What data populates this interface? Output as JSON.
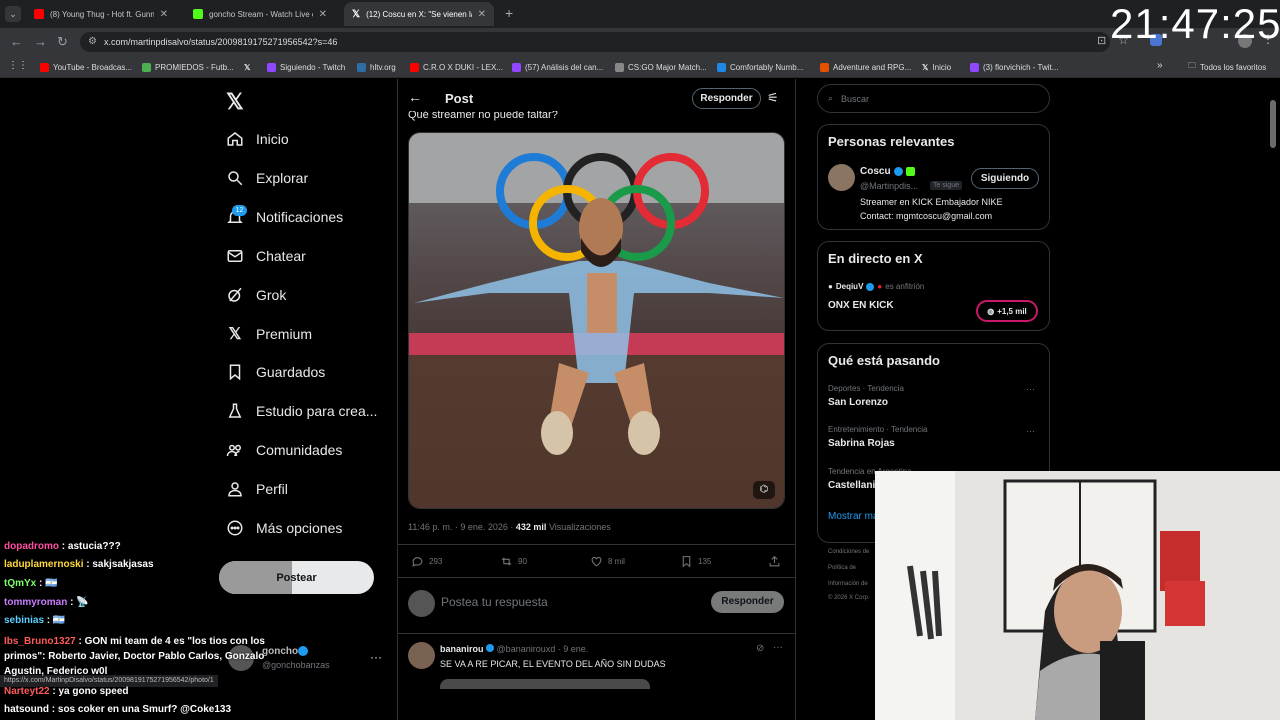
{
  "browser": {
    "tabs": [
      {
        "title": "(8) Young Thug - Hot ft. Gunna",
        "color": "#ff0000"
      },
      {
        "title": "goncho Stream - Watch Live on",
        "color": "#53fc18"
      },
      {
        "title": "(12) Coscu en X: \"Se vienen las",
        "color": "#ffffff"
      }
    ],
    "url": "x.com/martinpdisalvo/status/2009819175271956542?s=46",
    "bookmarks": [
      "YouTube - Broadcas...",
      "PROMIEDOS - Futb...",
      "",
      "Siguiendo - Twitch",
      "hltv.org",
      "C.R.O X DUKI - LEX...",
      "(57) Análisis del can...",
      "CS:GO Major Match...",
      "Comfortably Numb...",
      "Adventure and RPG...",
      "Inicio",
      "(3) florvichich - Twit..."
    ],
    "bookmarks_all": "Todos los favoritos",
    "clock": "21:47:25"
  },
  "sidebar": {
    "items": [
      {
        "label": "Inicio",
        "icon": "home-icon"
      },
      {
        "label": "Explorar",
        "icon": "search-icon"
      },
      {
        "label": "Notificaciones",
        "icon": "bell-icon"
      },
      {
        "label": "Chatear",
        "icon": "mail-icon"
      },
      {
        "label": "Grok",
        "icon": "grok-icon"
      },
      {
        "label": "Premium",
        "icon": "x-icon"
      },
      {
        "label": "Guardados",
        "icon": "bookmark-icon"
      },
      {
        "label": "Estudio para crea...",
        "icon": "flask-icon"
      },
      {
        "label": "Comunidades",
        "icon": "people-icon"
      },
      {
        "label": "Perfil",
        "icon": "person-icon"
      },
      {
        "label": "Más opciones",
        "icon": "more-icon"
      }
    ],
    "notif_badge": "12",
    "post_button": "Postear",
    "account_name": "goncho",
    "account_handle": "@gonchobanzas"
  },
  "post": {
    "header_title": "Post",
    "reply_button": "Responder",
    "text_partial": "Qué streamer no puede faltar?",
    "meta_time": "11:46 p. m. · 9 ene. 2026 · ",
    "meta_views": "432 mil",
    "meta_views_label": " Visualizaciones",
    "stats": {
      "replies": "293",
      "reposts": "90",
      "likes": "8 mil",
      "bookmarks": "135"
    },
    "reply_placeholder": "Postea tu respuesta",
    "reply_submit": "Responder",
    "reply": {
      "name": "bananirou",
      "handle": "@bananirouxd",
      "date": "· 9 ene.",
      "text": "SE VA A RE PICAR, EL EVENTO DEL AÑO SIN DUDAS"
    },
    "status_url": "https://x.com/MartinpDisalvo/status/2009819175271956542/photo/1"
  },
  "right": {
    "search_placeholder": "Buscar",
    "relevant_title": "Personas relevantes",
    "person": {
      "name": "Coscu",
      "handle": "@Martinpdis...",
      "follows_you": "Te sigue",
      "button": "Siguiendo",
      "bio1": "Streamer en KICK Embajador NIKE",
      "bio2": "Contact: mgmtcoscu@gmail.com"
    },
    "live_title": "En directo en X",
    "live": {
      "host": "DeqiuV",
      "host_label": "es anfitrión",
      "title": "ONX EN KICK",
      "count": "+1,5 mil"
    },
    "trends_title": "Qué está pasando",
    "trends": [
      {
        "category": "Deportes · Tendencia",
        "name": "San Lorenzo"
      },
      {
        "category": "Entretenimiento · Tendencia",
        "name": "Sabrina Rojas"
      },
      {
        "category": "Tendencia en Argentina",
        "name": "Castellani"
      }
    ],
    "show_more": "Mostrar más",
    "footer": [
      "Condiciones de",
      "Política de",
      "Información de",
      "© 2026 X Corp."
    ]
  },
  "chat": [
    {
      "user": "dopadromo",
      "msg": "astucia???",
      "color": "#ff4fa0"
    },
    {
      "user": "laduplamernoski",
      "msg": "sakjsakjasas",
      "color": "#ffd93b"
    },
    {
      "user": "tQmYx",
      "msg": "🇦🇷",
      "color": "#7dff6b"
    },
    {
      "user": "tommyroman",
      "msg": "📡",
      "color": "#c77dff"
    },
    {
      "user": "sebinias",
      "msg": "🇦🇷",
      "color": "#5ad1ff"
    },
    {
      "user": "Ibs_Bruno1327",
      "msg": "GON mi team de 4 es \"los tios con los primos\": Roberto Javier, Doctor Pablo Carlos, Gonzalo Agustin, Federico w0l",
      "color": "#ff5a5a"
    },
    {
      "user": "Narteyt22",
      "msg": "ya gono speed",
      "color": "#ff5a5a"
    },
    {
      "user": "hatsound",
      "msg": "sos coker en una Smurf? @Coke133",
      "color": "#ffffff"
    }
  ]
}
